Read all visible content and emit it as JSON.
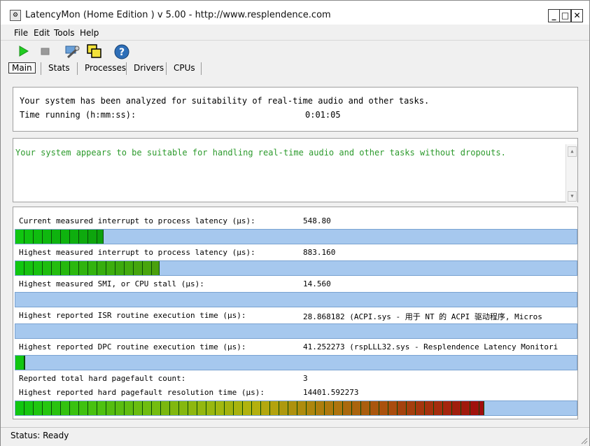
{
  "window": {
    "title": "LatencyMon  (Home Edition )  v 5.00 - http://www.resplendence.com",
    "min_glyph": "_",
    "max_glyph": "□",
    "close_glyph": "✕"
  },
  "menu": [
    {
      "label": "File"
    },
    {
      "label": "Edit"
    },
    {
      "label": "Tools"
    },
    {
      "label": "Help"
    }
  ],
  "toolbar": {
    "icons": [
      "play-icon",
      "stop-icon",
      "tools-icon",
      "windows-icon",
      "help-icon"
    ]
  },
  "tabs": [
    {
      "label": "Main",
      "active": true
    },
    {
      "label": "Stats",
      "active": false
    },
    {
      "label": "Processes",
      "active": false
    },
    {
      "label": "Drivers",
      "active": false
    },
    {
      "label": "CPUs",
      "active": false
    }
  ],
  "summary": {
    "line1": "Your system has been analyzed for suitability of real-time audio and other tasks.",
    "time_label": "Time running (h:mm:ss):",
    "time_value": "0:01:05"
  },
  "verdict": {
    "text": "Your system appears to be suitable for handling real-time audio and other tasks without dropouts.",
    "color": "#2c9a2c"
  },
  "metrics": [
    {
      "label": "Current measured interrupt to process latency (µs):",
      "value": "548.80",
      "fill_fraction": 0.157,
      "max_hue": 120
    },
    {
      "label": "Highest measured interrupt to process latency (µs):",
      "value": "883.160",
      "fill_fraction": 0.257,
      "max_hue": 95
    },
    {
      "label": "Highest measured SMI, or CPU stall (µs):",
      "value": "14.560",
      "fill_fraction": 0.0,
      "max_hue": 120
    },
    {
      "label": "Highest reported ISR routine execution time (µs):",
      "value": "28.868182  (ACPI.sys - 用于 NT 的 ACPI 驱动程序, Micros",
      "fill_fraction": 0.0,
      "max_hue": 120
    },
    {
      "label": "Highest reported DPC routine execution time (µs):",
      "value": "41.252273  (rspLLL32.sys - Resplendence Latency Monitori",
      "fill_fraction": 0.017,
      "max_hue": 120
    },
    {
      "label": "Reported total hard pagefault count:",
      "value": "3"
    },
    {
      "label": "Highest reported hard pagefault resolution time (µs):",
      "value": "14401.592273",
      "fill_fraction": 0.835,
      "max_hue": 0
    }
  ],
  "status": {
    "text": "Status: Ready"
  },
  "colors": {
    "bar_bg": "#a6c8ee",
    "accent_green": "#22cc22"
  }
}
